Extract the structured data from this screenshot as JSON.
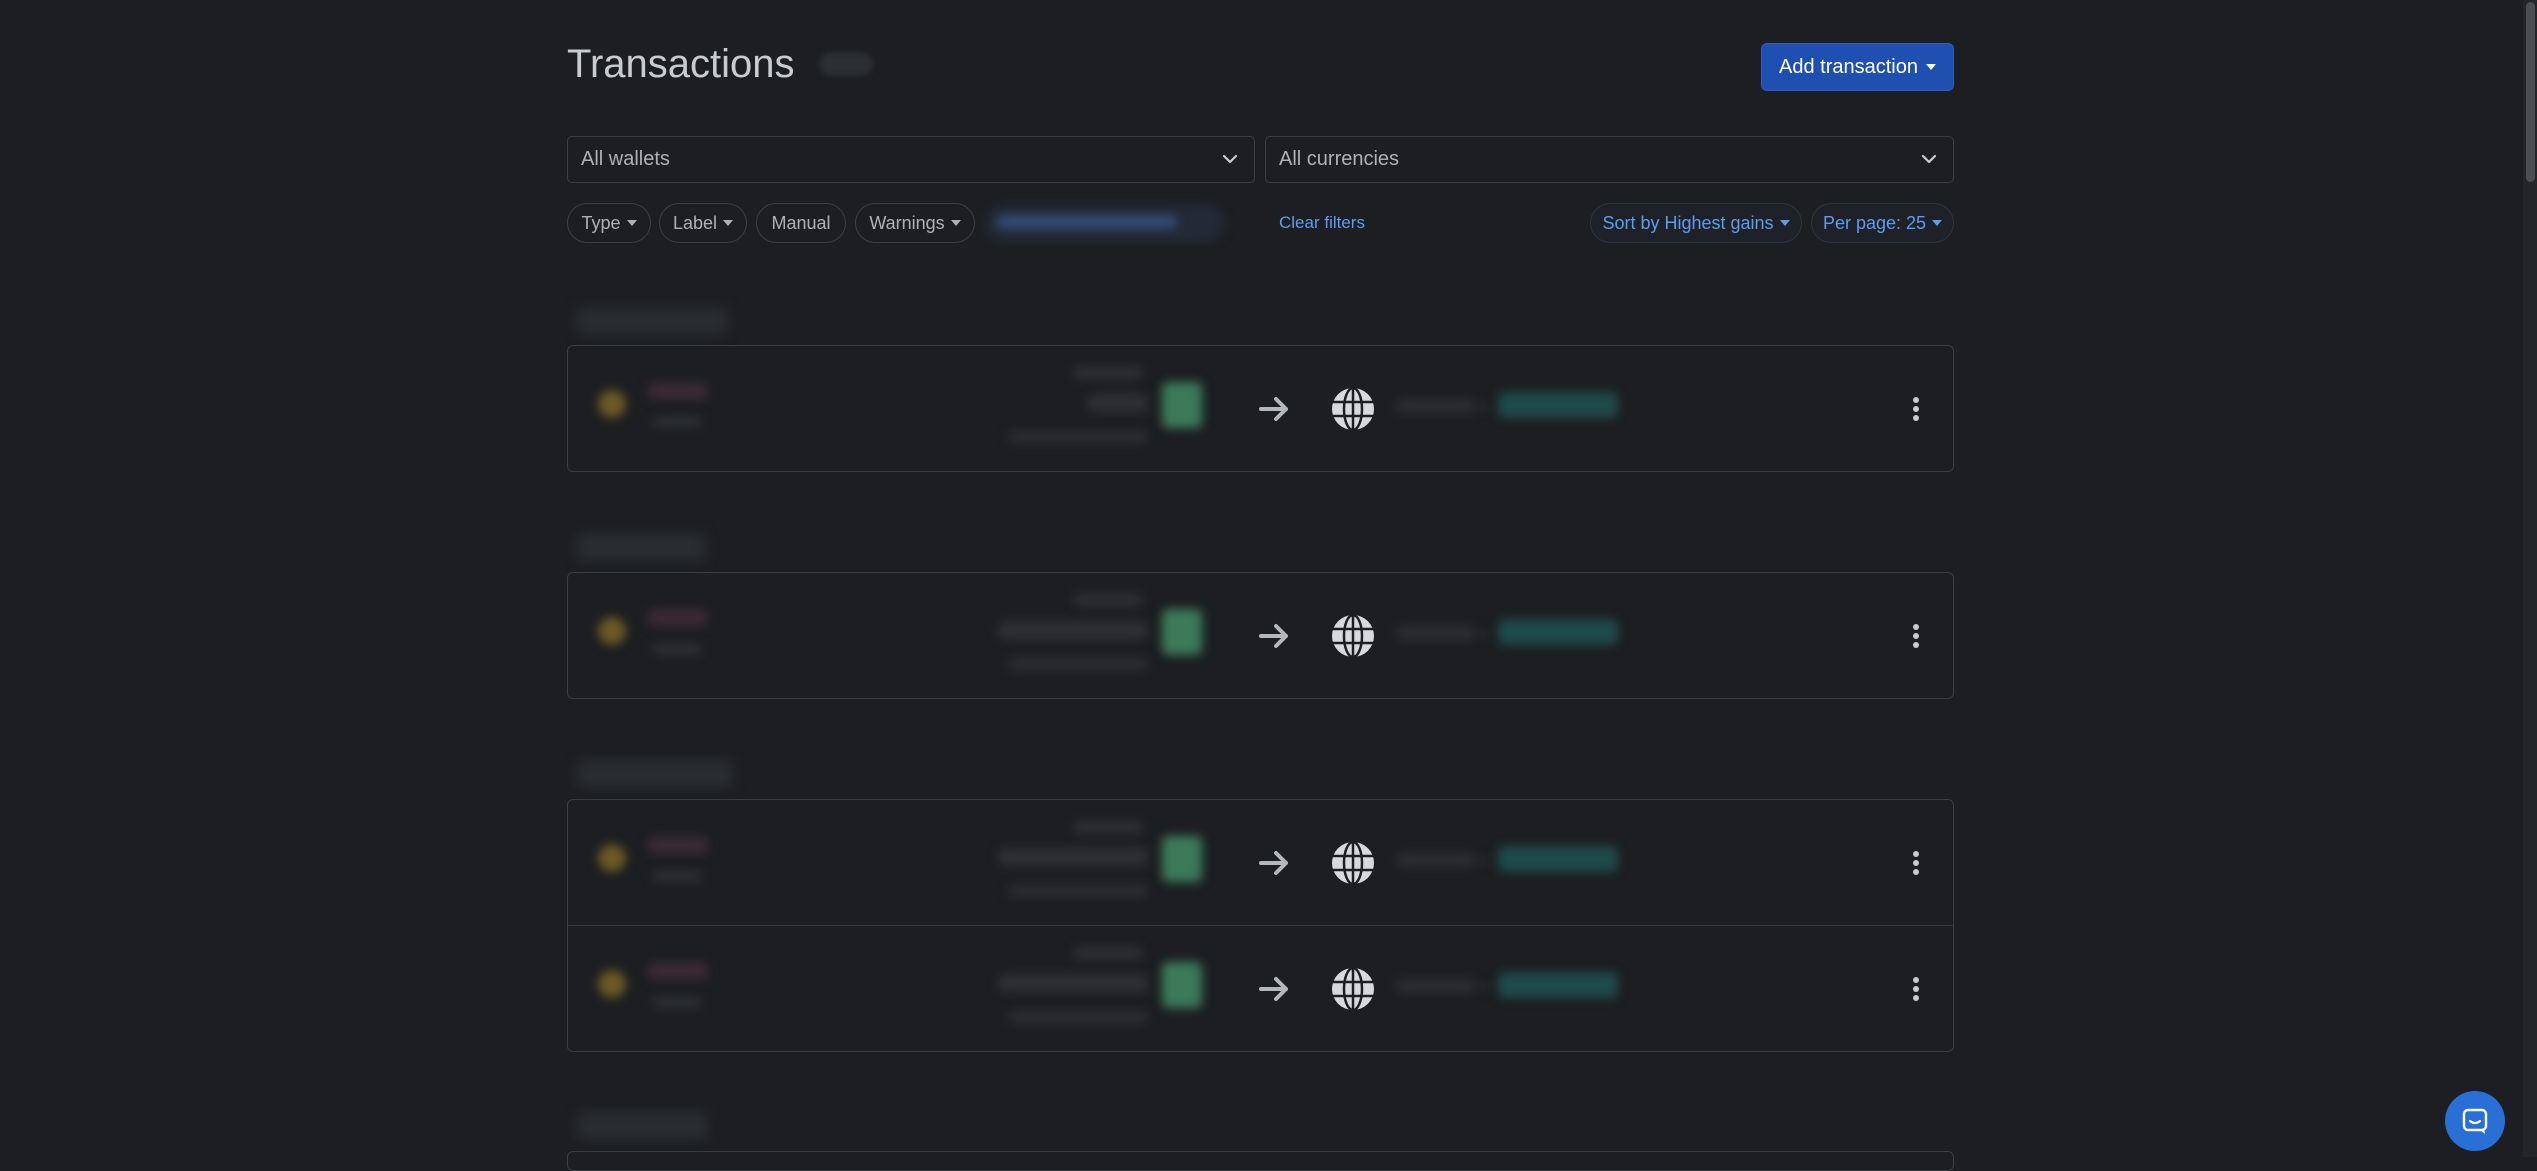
{
  "header": {
    "title": "Transactions",
    "add_button_label": "Add transaction"
  },
  "filters": {
    "wallets_select": "All wallets",
    "currencies_select": "All currencies",
    "type_label": "Type",
    "label_label": "Label",
    "manual_label": "Manual",
    "warnings_label": "Warnings",
    "clear_filters_label": "Clear filters",
    "sort_label": "Sort by Highest gains",
    "per_page_label": "Per page: 25"
  },
  "colors": {
    "background": "#1c1e21",
    "accent": "#1f4fb0",
    "link": "#5f9cf0"
  },
  "icons": [
    "chevron-down-icon",
    "arrow-right-icon",
    "globe-icon",
    "more-vertical-icon",
    "chat-icon"
  ]
}
